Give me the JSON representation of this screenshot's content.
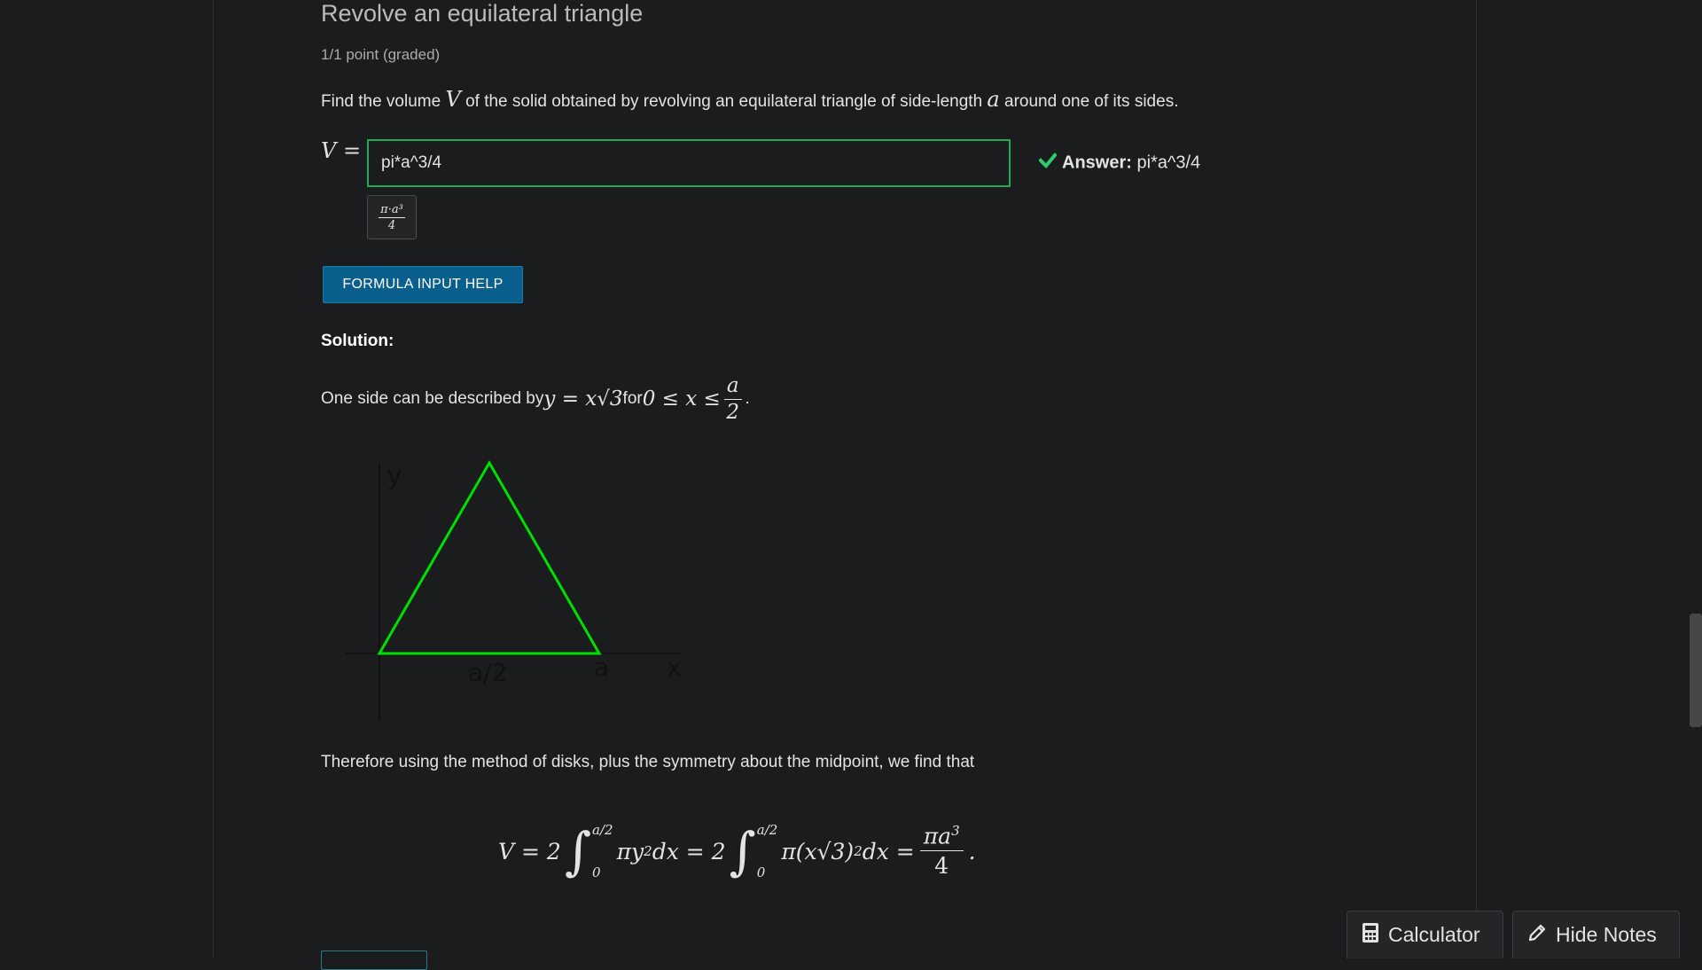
{
  "problem": {
    "title": "Revolve an equilateral triangle",
    "points": "1/1 point (graded)",
    "prompt": {
      "before_V": "Find the volume ",
      "V": "V",
      "middle": " of the solid obtained by revolving an equilateral triangle of side-length ",
      "a": "a",
      "after_a": " around one of its sides."
    },
    "input_label": "V =",
    "input_value": "pi*a^3/4",
    "status": {
      "label": "Answer:",
      "value": "pi*a^3/4",
      "correct": true,
      "color": "#2ecc71"
    },
    "preview": {
      "numerator": "π·a³",
      "denominator": "4"
    },
    "help_button": "FORMULA INPUT HELP"
  },
  "solution": {
    "heading": "Solution:",
    "desc_before": "One side can be described by ",
    "desc_eq": "y = x√3",
    "desc_for": " for ",
    "desc_range": "0 ≤ x ≤",
    "desc_frac_num": "a",
    "desc_frac_den": "2",
    "desc_end": ".",
    "figure": {
      "y_label": "y",
      "x_label": "x",
      "half_label": "a/2",
      "a_label": "a",
      "triangle_color": "#00e000"
    },
    "method_text": "Therefore using the method of disks, plus the symmetry about the midpoint, we find that",
    "eq": {
      "lhs": "V = 2",
      "upper": "a/2",
      "lower": "0",
      "int1_body": "πy",
      "sq": "2",
      "dx1": " dx = 2",
      "int2_body": "π(x√3)",
      "dx2": " dx =",
      "frac_num": "πa",
      "frac_pow": "3",
      "frac_den": "4",
      "end": "."
    }
  },
  "floating": {
    "calculator": "Calculator",
    "hide_notes": "Hide Notes"
  },
  "icons": {
    "check": "check-icon",
    "calculator": "calculator-icon",
    "pencil": "pencil-icon"
  },
  "colors": {
    "background": "#1b1c1d",
    "correct_border": "#2aa85a",
    "button_blue": "#0a5f8c"
  }
}
